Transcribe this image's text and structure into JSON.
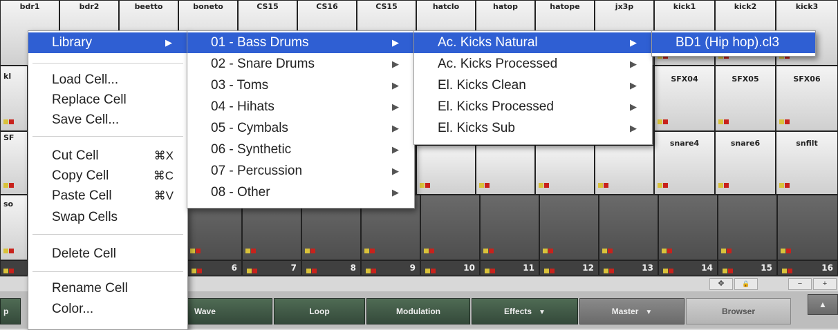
{
  "cells": {
    "row1": [
      "bdr1",
      "bdr2",
      "beetto",
      "boneto",
      "CS15",
      "CS16",
      "CS15",
      "hatclo",
      "hatop",
      "hatope",
      "jx3p",
      "kick1",
      "kick2",
      "kick3"
    ],
    "row2_partial": [
      "kl",
      "SFX04",
      "SFX05",
      "SFX06"
    ],
    "row3_partial": [
      "SF",
      "snare4",
      "snare6",
      "snfilt"
    ],
    "row4_partial": [
      "so"
    ],
    "bank_numbers": [
      "6",
      "7",
      "8",
      "9",
      "10",
      "11",
      "12",
      "13",
      "14",
      "15",
      "16"
    ]
  },
  "context_menu": {
    "items": [
      {
        "label": "Library",
        "arrow": "▶"
      },
      {
        "label": "Load Cell..."
      },
      {
        "label": "Replace Cell"
      },
      {
        "label": "Save Cell..."
      },
      {
        "label": "Cut Cell",
        "shortcut": "⌘X"
      },
      {
        "label": "Copy Cell",
        "shortcut": "⌘C"
      },
      {
        "label": "Paste Cell",
        "shortcut": "⌘V"
      },
      {
        "label": "Swap Cells"
      },
      {
        "label": "Delete Cell"
      },
      {
        "label": "Rename Cell"
      },
      {
        "label": "Color..."
      }
    ]
  },
  "library_menu": {
    "items": [
      "01 - Bass Drums",
      "02 - Snare Drums",
      "03 - Toms",
      "04 - Hihats",
      "05 - Cymbals",
      "06 - Synthetic",
      "07 - Percussion",
      "08 - Other"
    ]
  },
  "bass_drums_menu": {
    "items": [
      "Ac. Kicks Natural",
      "Ac. Kicks Processed",
      "El. Kicks Clean",
      "El. Kicks Processed",
      "El. Kicks Sub"
    ]
  },
  "kicks_natural_menu": {
    "items": [
      "BD1 (Hip hop).cl3"
    ]
  },
  "strip": {
    "move": "✥",
    "lock": "🔒",
    "minus": "−",
    "plus": "+"
  },
  "tabs": {
    "p": "p",
    "wave": "Wave",
    "loop": "Loop",
    "modulation": "Modulation",
    "effects": "Effects",
    "master": "Master",
    "browser": "Browser",
    "chev": "▼",
    "up": "▲"
  },
  "colors": {
    "highlight": "#2f5fd3",
    "tab_green": "#4f6b54",
    "led_yellow": "#d9c23a",
    "led_red": "#c8221c"
  }
}
